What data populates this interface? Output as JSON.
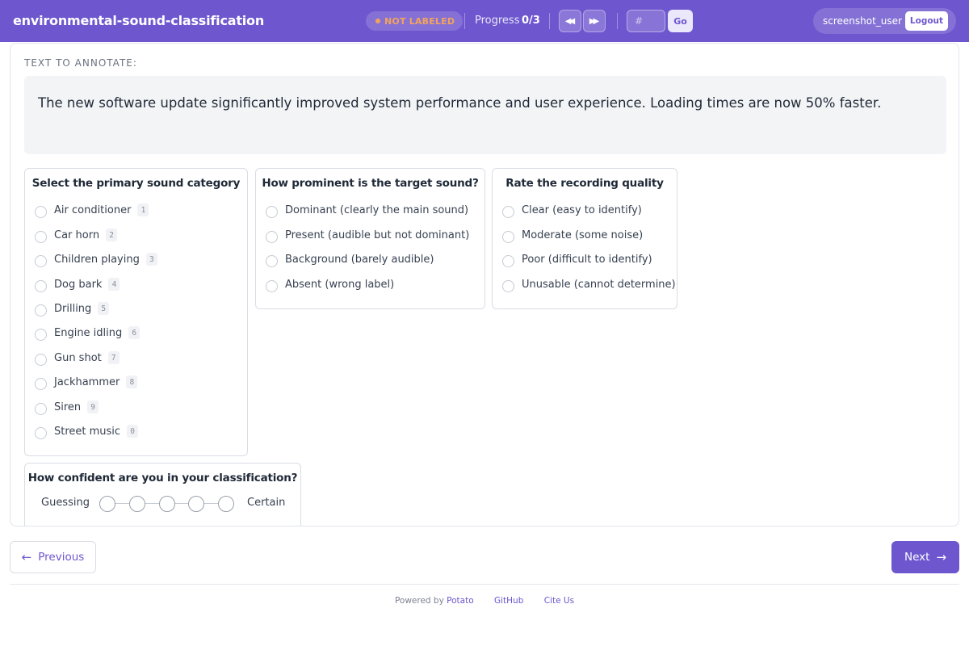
{
  "header": {
    "title": "environmental-sound-classification",
    "status": "NOT LABELED",
    "progress_label": "Progress",
    "progress_value": "0/3",
    "jump_placeholder": "#",
    "go_label": "Go",
    "username": "screenshot_user",
    "logout_label": "Logout"
  },
  "instance": {
    "section_label": "TEXT TO ANNOTATE:",
    "text": "The new software update significantly improved system performance and user experience. Loading times are now 50% faster."
  },
  "questions": {
    "category": {
      "title": "Select the primary sound category",
      "options": [
        {
          "label": "Air conditioner",
          "key": "1"
        },
        {
          "label": "Car horn",
          "key": "2"
        },
        {
          "label": "Children playing",
          "key": "3"
        },
        {
          "label": "Dog bark",
          "key": "4"
        },
        {
          "label": "Drilling",
          "key": "5"
        },
        {
          "label": "Engine idling",
          "key": "6"
        },
        {
          "label": "Gun shot",
          "key": "7"
        },
        {
          "label": "Jackhammer",
          "key": "8"
        },
        {
          "label": "Siren",
          "key": "9"
        },
        {
          "label": "Street music",
          "key": "0"
        }
      ]
    },
    "prominence": {
      "title": "How prominent is the target sound?",
      "options": [
        {
          "label": "Dominant (clearly the main sound)"
        },
        {
          "label": "Present (audible but not dominant)"
        },
        {
          "label": "Background (barely audible)"
        },
        {
          "label": "Absent (wrong label)"
        }
      ]
    },
    "quality": {
      "title": "Rate the recording quality",
      "options": [
        {
          "label": "Clear (easy to identify)"
        },
        {
          "label": "Moderate (some noise)"
        },
        {
          "label": "Poor (difficult to identify)"
        },
        {
          "label": "Unusable (cannot determine)"
        }
      ]
    },
    "confidence": {
      "title": "How confident are you in your classification?",
      "min_label": "Guessing",
      "max_label": "Certain",
      "points": 5
    }
  },
  "navigation": {
    "previous_label": "Previous",
    "next_label": "Next"
  },
  "footer": {
    "powered_by": "Powered by",
    "potato": "Potato",
    "github": "GitHub",
    "cite": "Cite Us"
  },
  "colors": {
    "accent": "#6e56cf",
    "status": "#f3a35c"
  },
  "icons": {
    "prev_icon": "arrow-left-icon",
    "next_icon": "arrow-right-icon",
    "rewind": "double-chevron-left-icon",
    "forward": "double-chevron-right-icon"
  }
}
